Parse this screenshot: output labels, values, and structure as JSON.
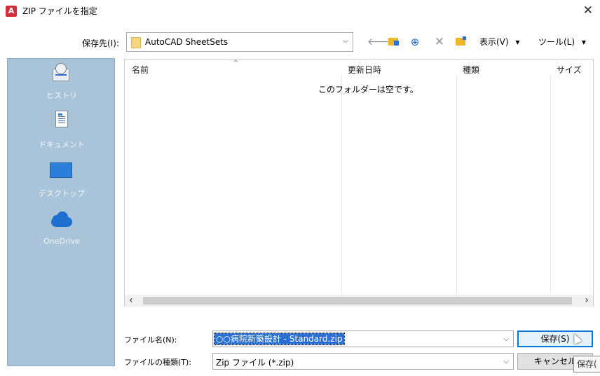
{
  "window": {
    "app_icon": "autocad-icon",
    "title": "ZIP ファイルを指定",
    "close_glyph": "✕"
  },
  "save_in": {
    "label": "保存先(I):",
    "value": "AutoCAD SheetSets",
    "arrow": "⌵"
  },
  "toolbar": {
    "back_glyph": "🡐",
    "search_web_glyph": "⊕",
    "delete_glyph": "✕",
    "view_label": "表示(V)",
    "view_arrow": "▾",
    "tools_label": "ツール(L)",
    "tools_arrow": "▾"
  },
  "places": [
    {
      "label": "ヒストリ",
      "icon": "history-icon"
    },
    {
      "label": "ドキュメント",
      "icon": "documents-icon"
    },
    {
      "label": "デスクトップ",
      "icon": "desktop-icon"
    },
    {
      "label": "OneDrive",
      "icon": "onedrive-icon"
    }
  ],
  "filelist": {
    "columns": [
      "名前",
      "更新日時",
      "種類",
      "サイズ"
    ],
    "sort_caret": "^",
    "empty_message": "このフォルダーは空です。",
    "scroll_left": "‹",
    "scroll_right": "›"
  },
  "file_name": {
    "label": "ファイル名(N):",
    "value": "○○病院新築設計 - Standard.zip",
    "arrow": "⌵"
  },
  "file_type": {
    "label": "ファイルの種類(T):",
    "value": "Zip ファイル (*.zip)",
    "arrow": "⌵"
  },
  "buttons": {
    "save": "保存(S)",
    "cancel": "キャンセル"
  },
  "tooltip": {
    "text": "保存("
  },
  "colors": {
    "places_bg": "#a9c3d9",
    "selection": "#2a6fd1",
    "default_button_border": "#0078d7",
    "app_icon": "#d0303c"
  }
}
